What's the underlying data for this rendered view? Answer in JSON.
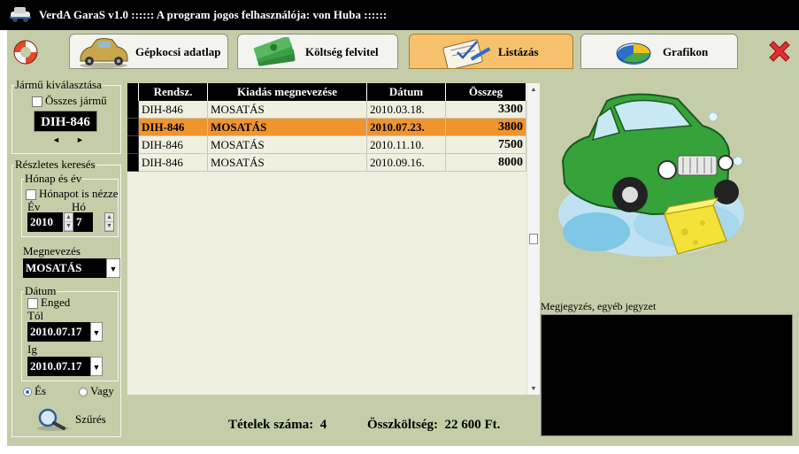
{
  "window": {
    "title": "VerdA GaraS  v1.0  :::::: A program jogos felhasználója:  von Huba ::::::"
  },
  "tabs": [
    {
      "label": "Gépkocsi adatlap",
      "active": false
    },
    {
      "label": "Költség felvitel",
      "active": false
    },
    {
      "label": "Listázás",
      "active": true
    },
    {
      "label": "Grafikon",
      "active": false
    }
  ],
  "vehicle_select": {
    "legend": "Jármű kiválasztása",
    "all_vehicles_label": "Összes jármű",
    "all_vehicles_checked": false,
    "plate": "DIH-846",
    "prev_arrow": "◄",
    "next_arrow": "►"
  },
  "detail_search": {
    "legend": "Részletes keresés",
    "month_year": {
      "legend": "Hónap és év",
      "month_too_label": "Hónapot is nézze",
      "month_too_checked": false,
      "year_label": "Év",
      "month_label": "Hó",
      "year_value": "2010",
      "month_value": "7"
    },
    "name_label": "Megnevezés",
    "name_value": "MOSATÁS",
    "date": {
      "legend": "Dátum",
      "enable_label": "Enged",
      "enable_checked": false,
      "from_label": "Tól",
      "from_value": "2010.07.17",
      "to_label": "Ig",
      "to_value": "2010.07.17"
    },
    "and_label": "És",
    "or_label": "Vagy",
    "and_selected": true,
    "filter_label": "Szűrés"
  },
  "table": {
    "columns": [
      "Rendsz.",
      "Kiadás megnevezése",
      "Dátum",
      "Összeg"
    ],
    "rows": [
      {
        "plate": "DIH-846",
        "name": "MOSATÁS",
        "date": "2010.03.18.",
        "amount": "3300",
        "selected": false
      },
      {
        "plate": "DIH-846",
        "name": "MOSATÁS",
        "date": "2010.07.23.",
        "amount": "3800",
        "selected": true
      },
      {
        "plate": "DIH-846",
        "name": "MOSATÁS",
        "date": "2010.11.10.",
        "amount": "7500",
        "selected": false
      },
      {
        "plate": "DIH-846",
        "name": "MOSATÁS",
        "date": "2010.09.16.",
        "amount": "8000",
        "selected": false
      }
    ]
  },
  "summary": {
    "count_label": "Tételek száma:",
    "count_value": "4",
    "total_label": "Összköltség:",
    "total_value": "22 600 Ft."
  },
  "notes": {
    "label": "Megjegyzés, egyéb jegyzet",
    "value": ""
  },
  "colors": {
    "panel": "#c4cda8",
    "active_tab": "#f6c06c",
    "selected_row": "#f0942e",
    "close_red": "#e03030"
  },
  "icons": {
    "lifebuoy": "lifebuoy-icon",
    "close": "close-x-icon",
    "car": "car-icon",
    "money": "money-icon",
    "list": "list-clipboard-icon",
    "chart": "pie-chart-icon",
    "search": "magnifier-icon"
  }
}
